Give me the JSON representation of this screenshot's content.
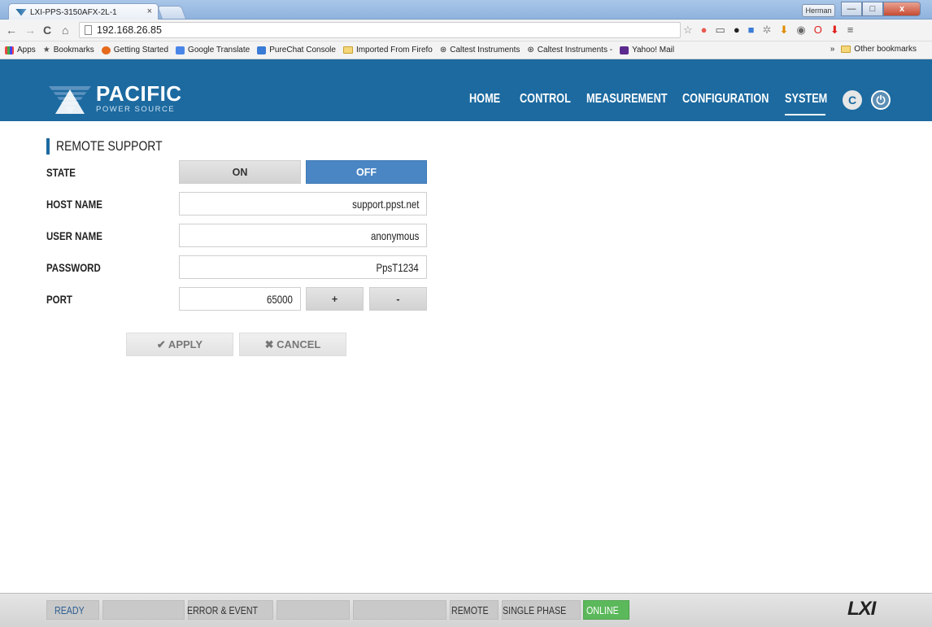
{
  "browser": {
    "tab_title": "LXI-PPS-3150AFX-2L-1",
    "tab_close": "×",
    "user": "Herman",
    "url": "192.168.26.85",
    "win_min": "—",
    "win_max": "□",
    "win_close": "x",
    "bookmarks": [
      {
        "label": "Apps",
        "icon": "apps-icon"
      },
      {
        "label": "Bookmarks",
        "icon": "star-icon"
      },
      {
        "label": "Getting Started",
        "icon": "firefox-icon"
      },
      {
        "label": "Google Translate",
        "icon": "translate-icon"
      },
      {
        "label": "PureChat Console",
        "icon": "chat-icon"
      },
      {
        "label": "Imported From Firefo",
        "icon": "folder-icon"
      },
      {
        "label": "Caltest Instruments",
        "icon": "caltest-icon"
      },
      {
        "label": "Caltest Instruments -",
        "icon": "caltest-icon"
      },
      {
        "label": "Yahoo! Mail",
        "icon": "yahoo-icon"
      }
    ],
    "bookmarks_overflow": "»",
    "other_bookmarks": "Other bookmarks"
  },
  "header": {
    "logo_main": "PACIFIC",
    "logo_sub": "POWER SOURCE",
    "nav": [
      "HOME",
      "CONTROL",
      "MEASUREMENT",
      "CONFIGURATION",
      "SYSTEM"
    ],
    "active_nav": "SYSTEM",
    "refresh_glyph": "C",
    "power_glyph": "⏻"
  },
  "remote_support": {
    "title": "REMOTE SUPPORT",
    "state_label": "STATE",
    "on_label": "ON",
    "off_label": "OFF",
    "state": "OFF",
    "host_label": "HOST NAME",
    "host_value": "support.ppst.net",
    "user_label": "USER NAME",
    "user_value": "anonymous",
    "password_label": "PASSWORD",
    "password_value": "PpsT1234",
    "port_label": "PORT",
    "port_value": "65000",
    "plus_label": "+",
    "minus_label": "-",
    "apply_label": "✔ APPLY",
    "cancel_label": "✖ CANCEL"
  },
  "statusbar": {
    "ready": "READY",
    "error_event": "ERROR & EVENT",
    "remote": "REMOTE",
    "phase": "SINGLE PHASE",
    "online": "ONLINE",
    "lxi": "LXI"
  },
  "colors": {
    "brand_blue": "#1c6aa0",
    "active_button": "#4a86c4",
    "online_green": "#5bb85b"
  }
}
